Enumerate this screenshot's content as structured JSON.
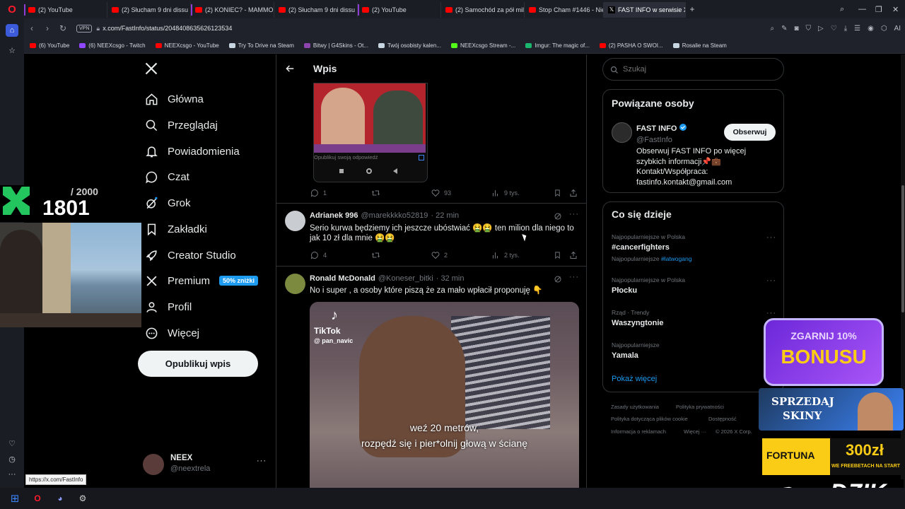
{
  "browser": {
    "tabs": [
      {
        "title": "(2) YouTube",
        "kind": "yt"
      },
      {
        "title": "(2) Słucham 9 dni dissu na...",
        "kind": "yt"
      },
      {
        "title": "(2) KONIEC? - MAMMON...",
        "kind": "yt"
      },
      {
        "title": "(2) Słucham 9 dni dissu na...",
        "kind": "yt"
      },
      {
        "title": "(2) YouTube",
        "kind": "yt"
      },
      {
        "title": "(2) Samochód za pół milio...",
        "kind": "yt"
      },
      {
        "title": "Stop Cham #1446 - Niebe...",
        "kind": "yt"
      },
      {
        "title": "FAST INFO w serwisie X: „...",
        "kind": "x"
      }
    ],
    "vpn": "VPN",
    "url": "x.com/FastInfo/status/2048408635626123534",
    "ai_label": "AI",
    "bookmarks": [
      "(6) YouTube",
      "(6) NEEXcsgo - Twitch",
      "NEEXcsgo - YouTube",
      "Try To Drive na Steam",
      "Bitwy | G4Skins - Ot...",
      "Twój osobisty kalen...",
      "NEEXcsgo Stream -...",
      "Imgur: The magic of...",
      "(2) PASHA O SWOI...",
      "Rosalie na Steam"
    ],
    "status_url": "https://x.com/FastInfo"
  },
  "nav": {
    "items": [
      {
        "label": "Główna",
        "icon": "home-icon"
      },
      {
        "label": "Przeglądaj",
        "icon": "search-icon"
      },
      {
        "label": "Powiadomienia",
        "icon": "bell-icon"
      },
      {
        "label": "Czat",
        "icon": "chat-icon"
      },
      {
        "label": "Grok",
        "icon": "grok-icon"
      },
      {
        "label": "Zakładki",
        "icon": "bookmark-icon"
      },
      {
        "label": "Creator Studio",
        "icon": "rocket-icon"
      },
      {
        "label": "Premium",
        "icon": "x-logo-icon"
      },
      {
        "label": "Profil",
        "icon": "person-icon"
      },
      {
        "label": "Więcej",
        "icon": "more-circle-icon"
      }
    ],
    "premium_badge": "50% zniżki",
    "post_button": "Opublikuj wpis",
    "account": {
      "name": "NEEX",
      "handle": "@neextrela"
    }
  },
  "header": {
    "title": "Wpis"
  },
  "embed": {
    "reply_placeholder": "Opublikuj swoją odpowiedź"
  },
  "first_actions": {
    "replies": "1",
    "likes": "93",
    "views": "9 tys."
  },
  "posts": [
    {
      "name": "Adrianek 996",
      "handle": "@marekkkko52819",
      "time": "· 22 min",
      "text": "Serio kurwa będziemy ich jeszcze ubóstwiać 🤮🤮 ten milion dla niego to jak 10 zł dla mnie 🤮🤮",
      "replies": "4",
      "likes": "2",
      "views": "2 tys."
    },
    {
      "name": "Ronald McDonald",
      "handle": "@Koneser_bitki",
      "time": "· 32 min",
      "text": "No i super , a osoby które  piszą że za mało wpłacił proponuję 👇",
      "video_brand": "TikTok",
      "video_user": "@ pan_navic",
      "subtitle_1": "weź 20 metrów,",
      "subtitle_2": "rozpędź się i pier*olnij głową w ścianę"
    }
  ],
  "search": {
    "placeholder": "Szukaj"
  },
  "related": {
    "title": "Powiązane osoby",
    "name": "FAST INFO",
    "handle": "@FastInfo",
    "follow_button": "Obserwuj",
    "bio": [
      "Obserwuj FAST INFO po więcej",
      "szybkich informacji📌💼",
      "Kontakt/Współpraca:",
      "fastinfo.kontakt@gmail.com"
    ]
  },
  "trends": {
    "title": "Co się dzieje",
    "items": [
      {
        "category": "Najpopularniejsze w Polska",
        "name": "#cancerfighters",
        "extra_prefix": "Najpopularniejsze",
        "extra_tag": "#latwogang"
      },
      {
        "category": "Najpopularniejsze w Polska",
        "name": "Płocku"
      },
      {
        "category": "Rząd · Trendy",
        "name": "Waszyngtonie"
      },
      {
        "category": "Najpopularniejsze",
        "name": "Yamala"
      }
    ],
    "show_more": "Pokaż więcej"
  },
  "footer": {
    "links": [
      "Zasady użytkowania",
      "Polityka prywatności",
      "Polityka dotycząca plików cookie",
      "Dostępność",
      "Informacja o reklamach",
      "Więcej ···",
      "© 2026 X Corp."
    ]
  },
  "overlay": {
    "counter_total": "/ 2000",
    "counter_value": "1801",
    "ad_bonus_top": "ZGARNIJ 10%",
    "ad_bonus": "BONUSU",
    "ad_skins_1": "SPRZEDAJ",
    "ad_skins_2": "SKINY",
    "ad_fortuna": "FORTUNA",
    "ad_fortuna_amount": "300zł",
    "ad_fortuna_sub": "WE FREEBETACH NA START",
    "ad_dzik": "DZIK"
  },
  "colors": {
    "accent": "#1d9bf0",
    "bg": "#000000",
    "border": "#2f3336",
    "muted": "#71767b"
  }
}
